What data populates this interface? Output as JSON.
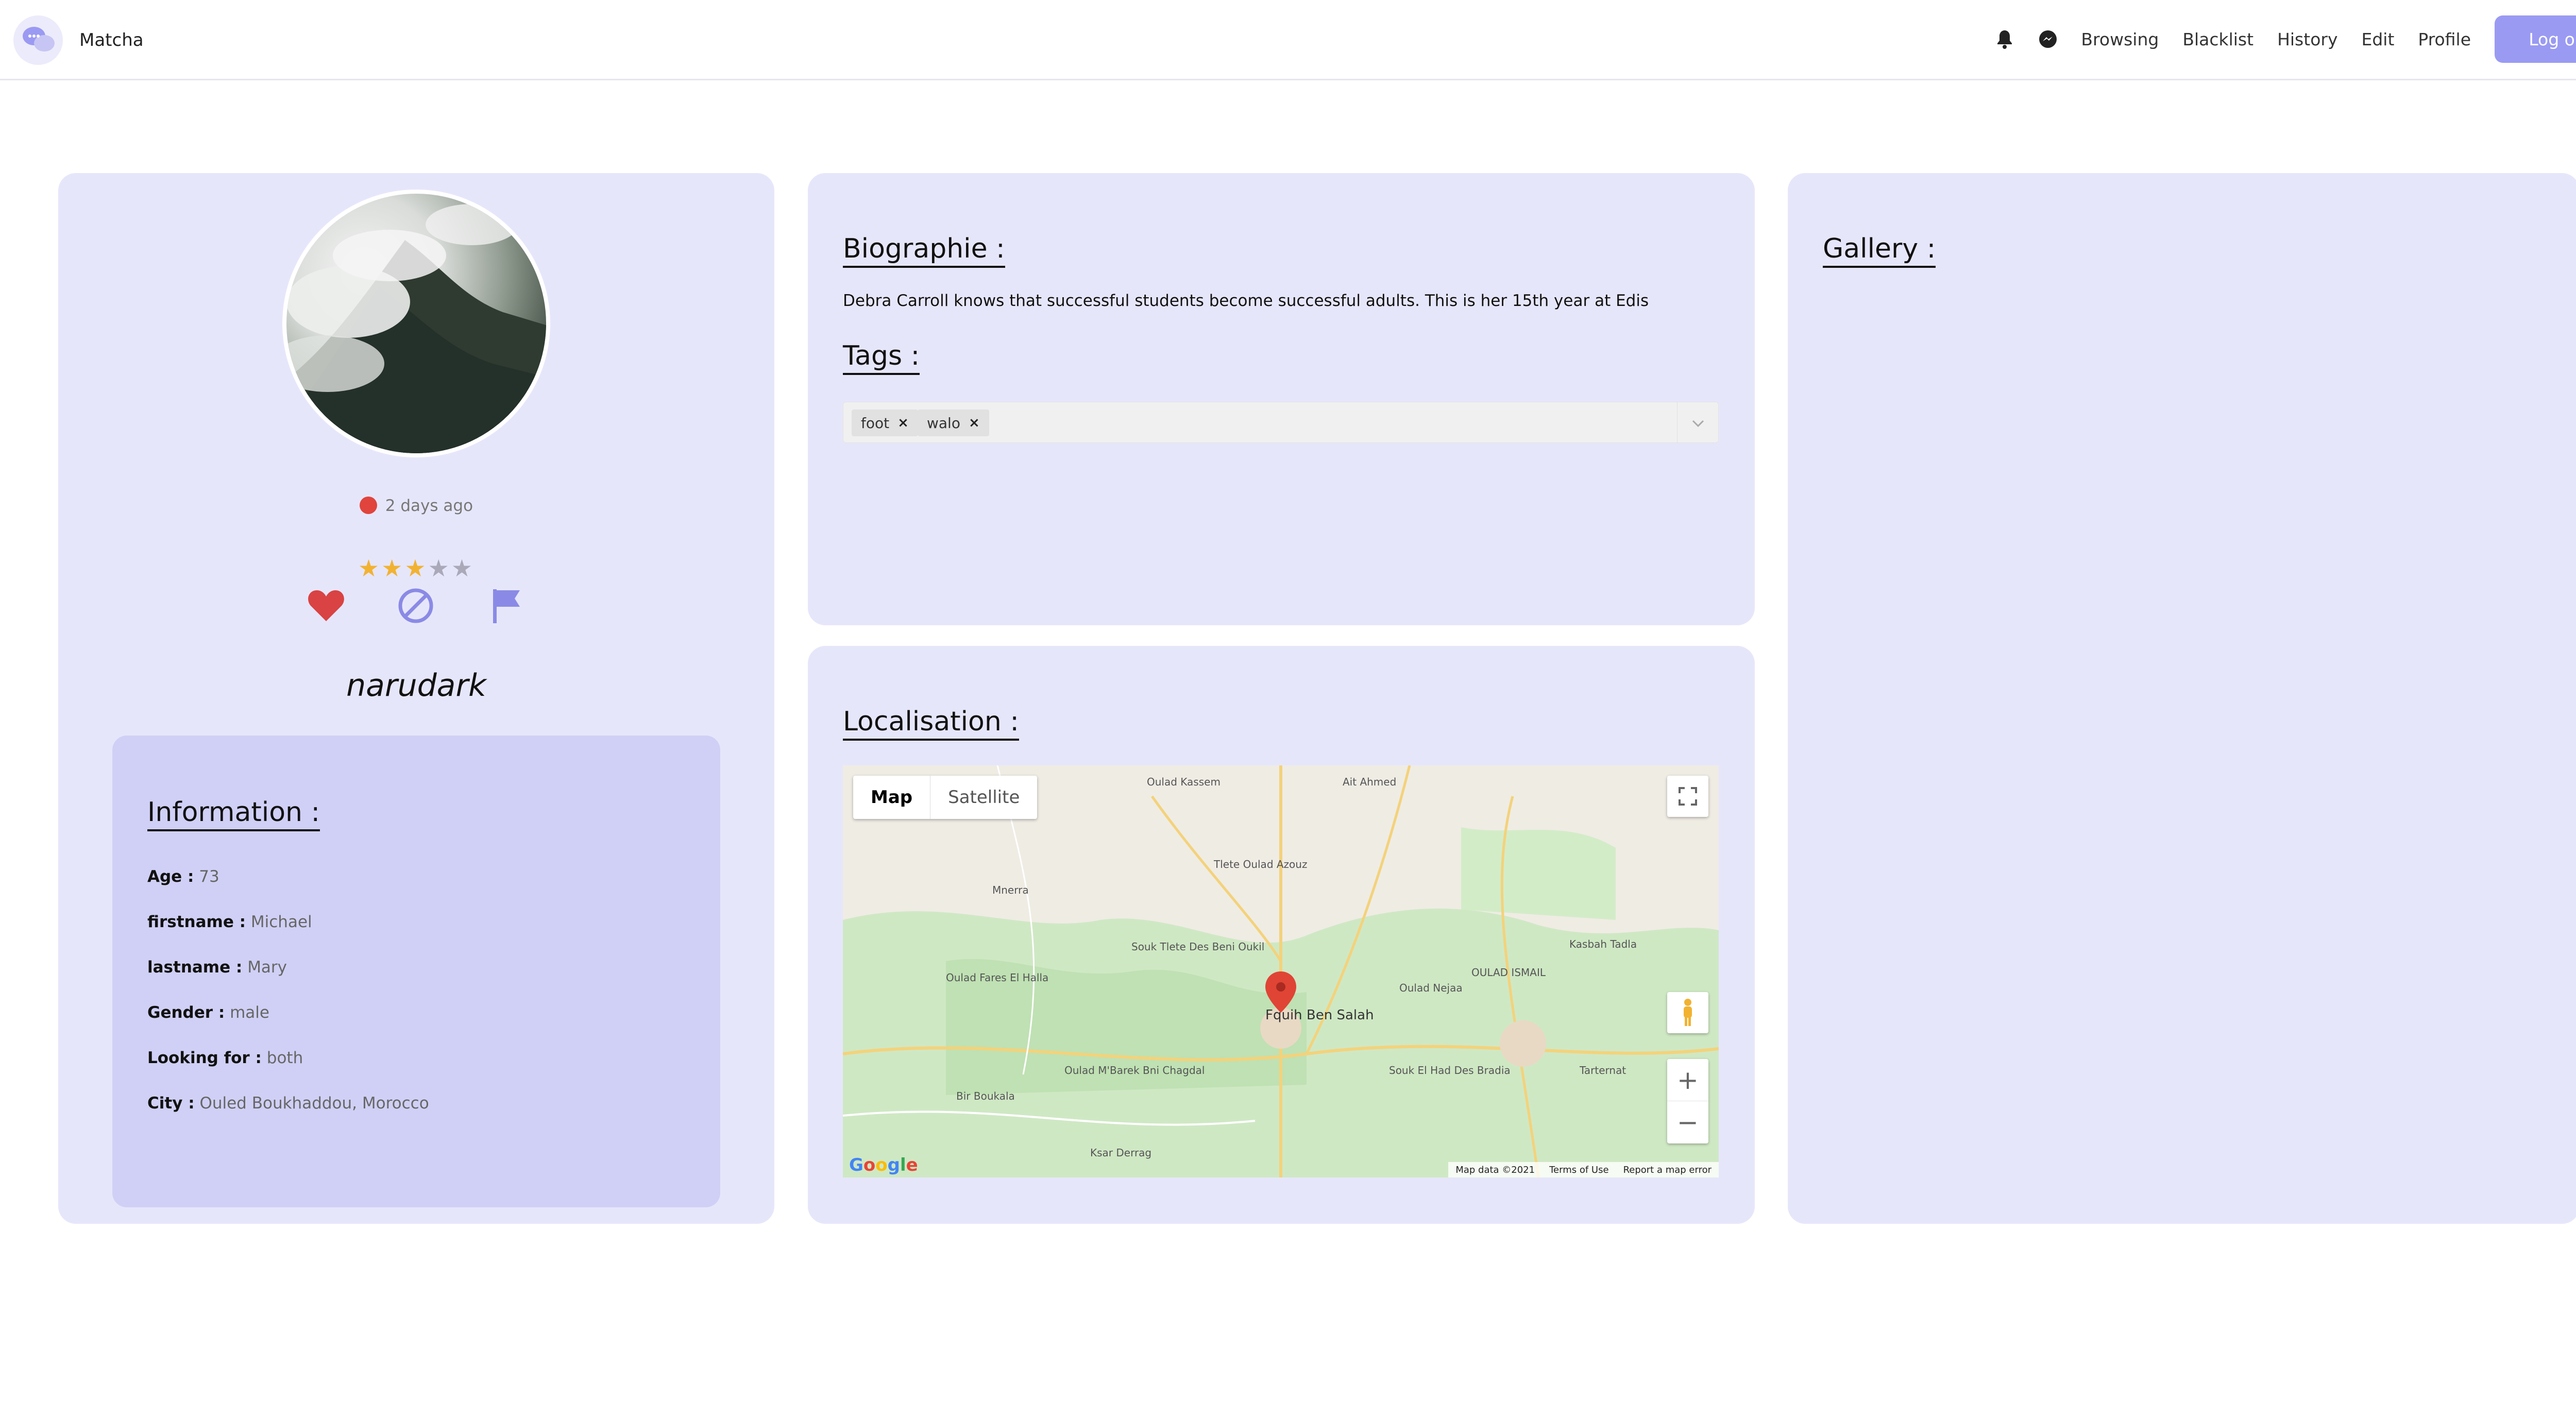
{
  "app": {
    "name": "Matcha"
  },
  "nav": {
    "links": [
      "Browsing",
      "Blacklist",
      "History",
      "Edit",
      "Profile"
    ],
    "logout": "Log out",
    "icons": [
      "bell-icon",
      "messenger-icon"
    ]
  },
  "profile": {
    "last_seen": "2 days ago",
    "status_color": "#e0443c",
    "rating": 3,
    "rating_max": 5,
    "username": "narudark",
    "information_title": "Information :",
    "info": {
      "age_label": "Age :",
      "age": "73",
      "firstname_label": "firstname :",
      "firstname": "Michael",
      "lastname_label": "lastname :",
      "lastname": "Mary",
      "gender_label": "Gender :",
      "gender": "male",
      "looking_label": "Looking for :",
      "looking": "both",
      "city_label": "City :",
      "city": "Ouled Boukhaddou, Morocco"
    }
  },
  "bio": {
    "title": "Biographie :",
    "text": "Debra Carroll knows that successful students become successful adults. This is her 15th year at Edis"
  },
  "tags": {
    "title": "Tags :",
    "items": [
      "foot",
      "walo"
    ]
  },
  "location": {
    "title": "Localisation :",
    "map_tab": "Map",
    "satellite_tab": "Satellite",
    "town": "Fquih Ben Salah",
    "attribution": [
      "Map data ©2021",
      "Terms of Use",
      "Report a map error"
    ],
    "google": "Google"
  },
  "gallery": {
    "title": "Gallery :"
  },
  "colors": {
    "card": "#e6e6fb",
    "info_box": "#d0d0f6",
    "accent": "#9a9af3",
    "heart": "#d94343",
    "star": "#f2b231"
  }
}
